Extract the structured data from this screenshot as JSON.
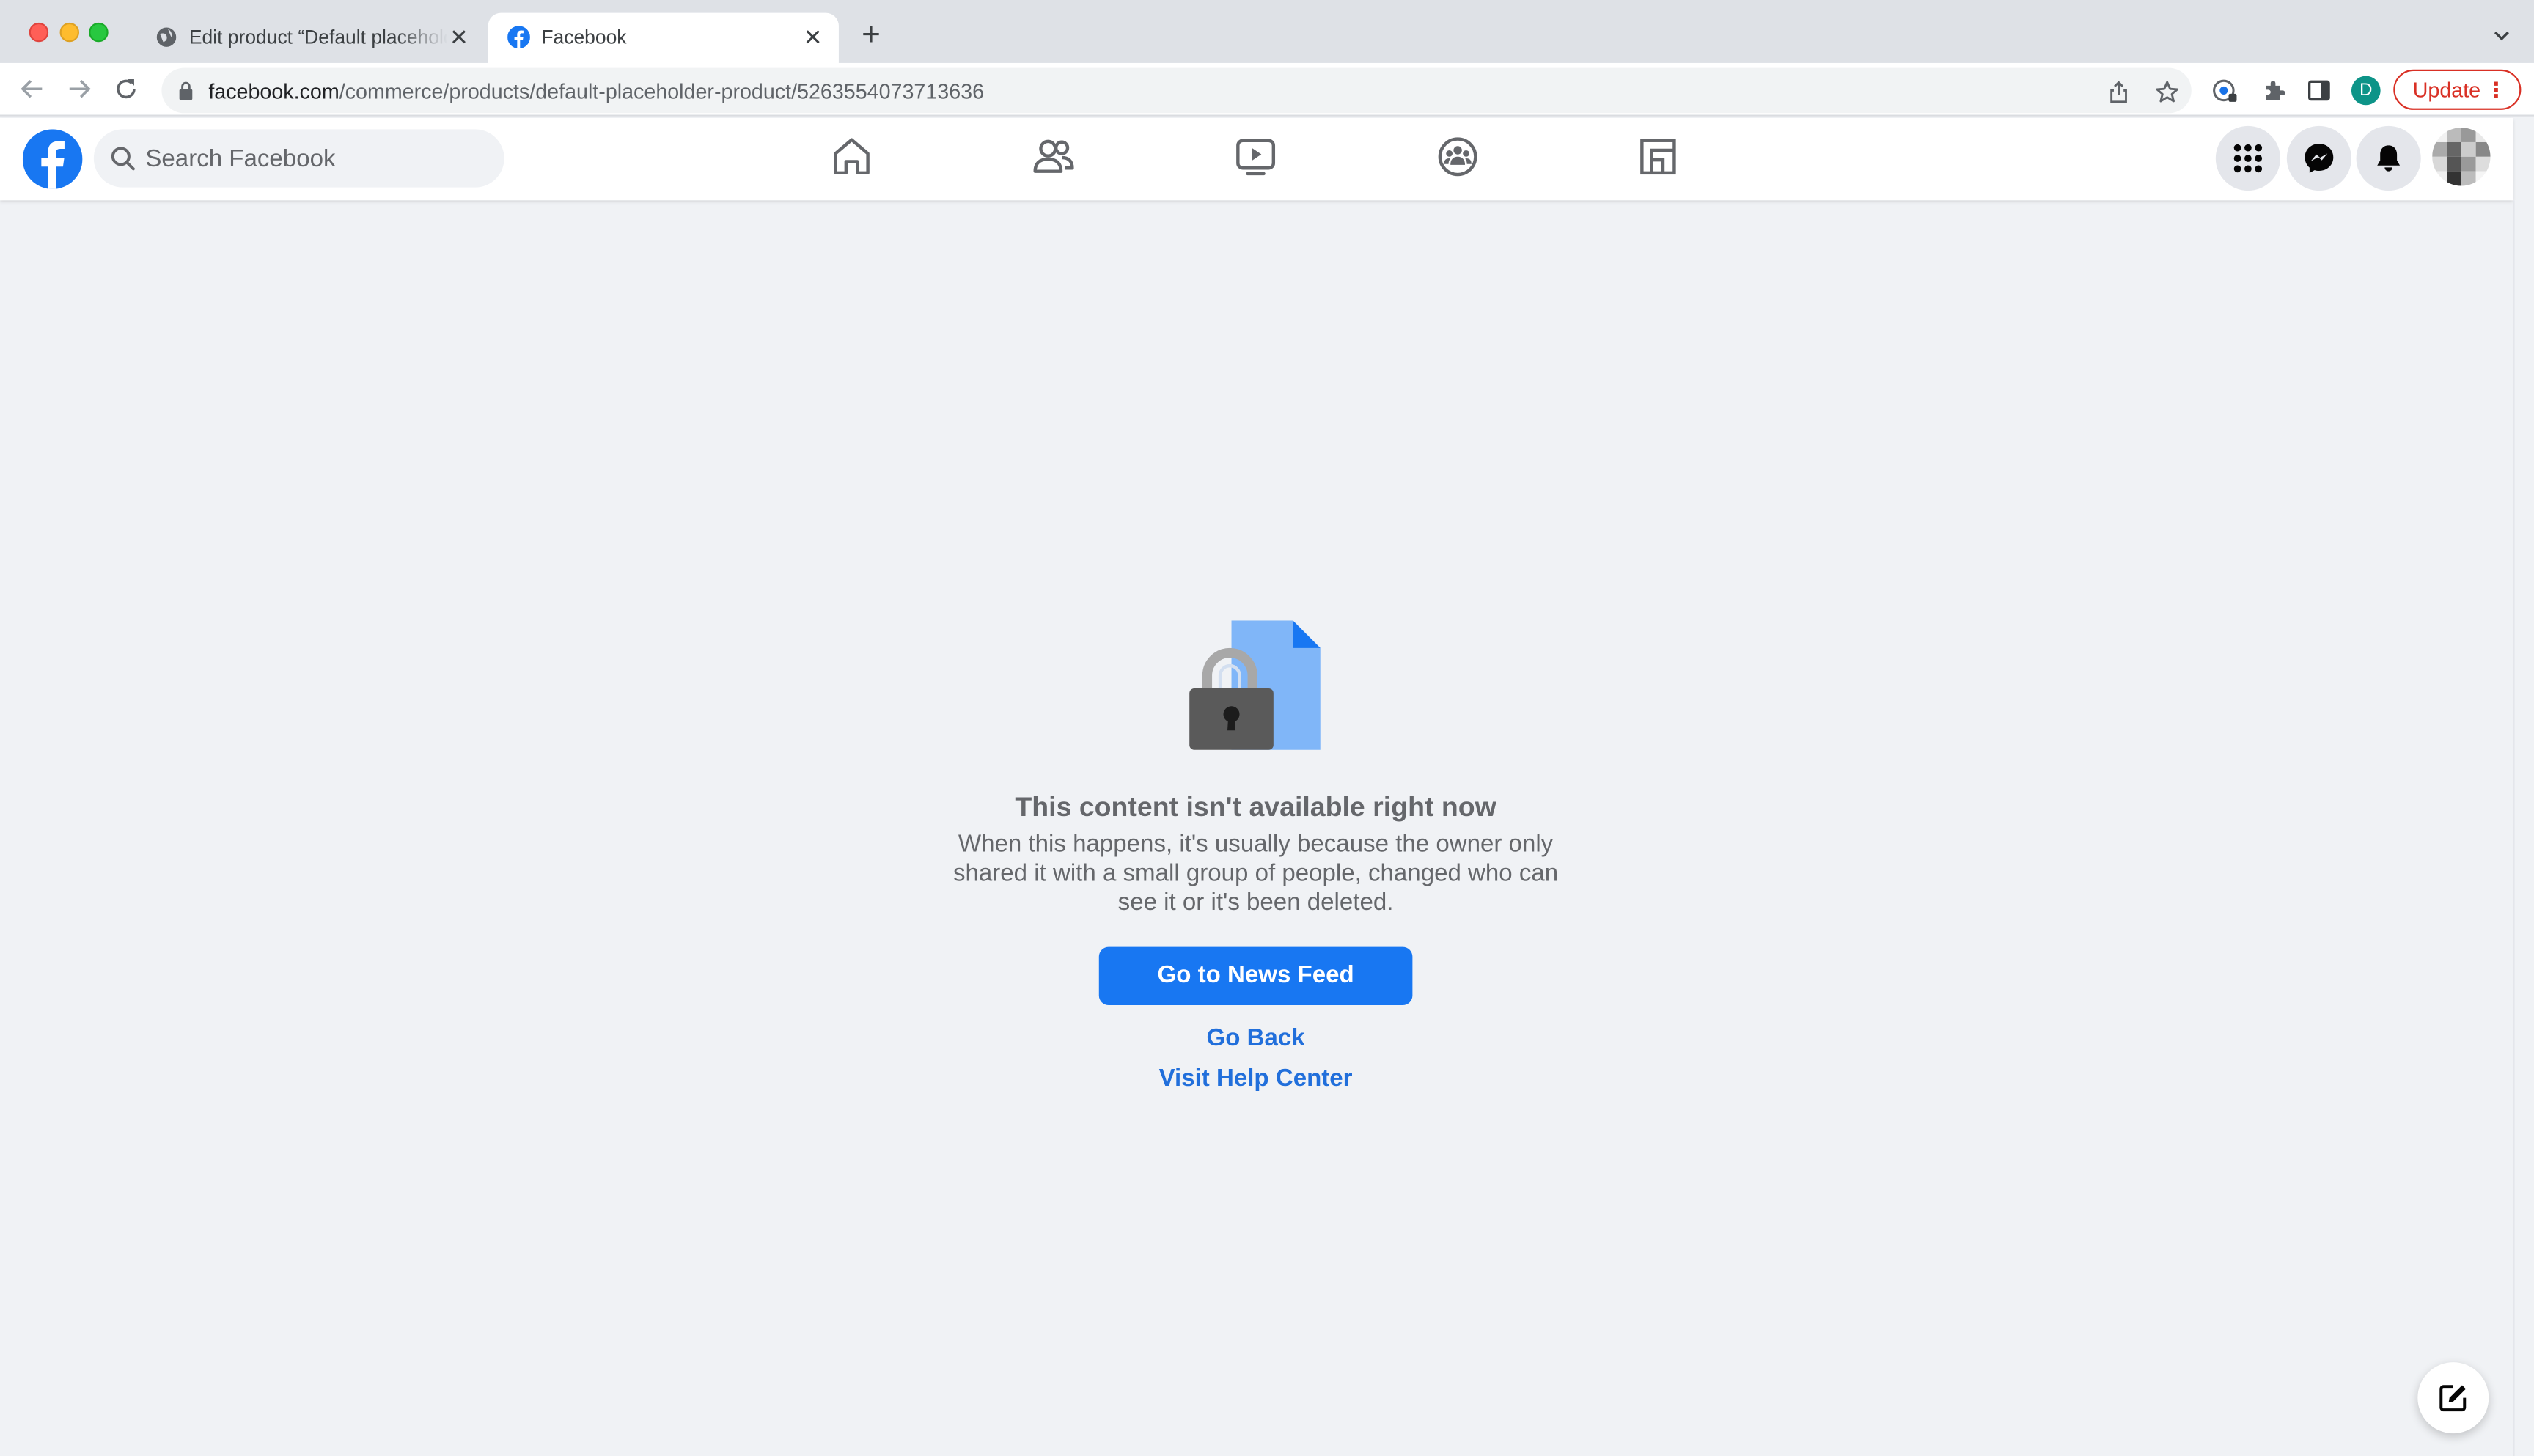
{
  "browser": {
    "tabs": [
      {
        "title": "Edit product “Default placeholder product”",
        "active": false
      },
      {
        "title": "Facebook",
        "active": true
      }
    ],
    "url_domain": "facebook.com",
    "url_path": "/commerce/products/default-placeholder-product/5263554073713636",
    "profile_initial": "D",
    "update_label": "Update",
    "colors": {
      "update": "#d93025",
      "profile": "#0d9488"
    }
  },
  "fb": {
    "search_placeholder": "Search Facebook",
    "nav_items": [
      "home-icon",
      "friends-icon",
      "watch-icon",
      "groups-icon",
      "gaming-icon"
    ],
    "brand_color": "#1877f2"
  },
  "content": {
    "title": "This content isn't available right now",
    "description": "When this happens, it's usually because the owner only shared it with a small group of people, changed who can see it or it's been deleted.",
    "primary_button": "Go to News Feed",
    "link_back": "Go Back",
    "link_help": "Visit Help Center"
  }
}
